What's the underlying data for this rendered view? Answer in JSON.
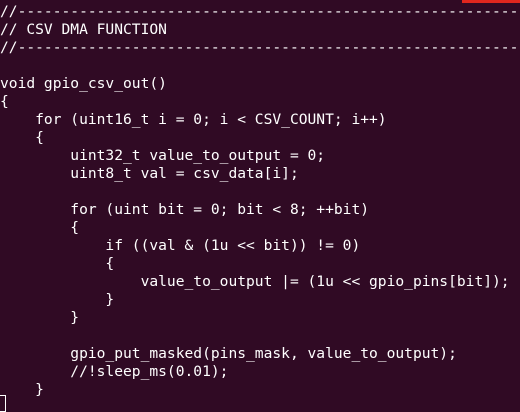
{
  "code_lines": [
    "//--------------------------------------------------------------------",
    "// CSV DMA FUNCTION",
    "//--------------------------------------------------------------------",
    "",
    "void gpio_csv_out()",
    "{",
    "    for (uint16_t i = 0; i < CSV_COUNT; i++)",
    "    {",
    "        uint32_t value_to_output = 0;",
    "        uint8_t val = csv_data[i];",
    "",
    "        for (uint bit = 0; bit < 8; ++bit)",
    "        {",
    "            if ((val & (1u << bit)) != 0)",
    "            {",
    "                value_to_output |= (1u << gpio_pins[bit]);",
    "            }",
    "        }",
    "",
    "        gpio_put_masked(pins_mask, value_to_output);",
    "        //!sleep_ms(0.01);",
    "    }",
    ""
  ],
  "colors": {
    "background": "#300A24",
    "text": "#FFFFFF",
    "accent": "#E0261E"
  }
}
